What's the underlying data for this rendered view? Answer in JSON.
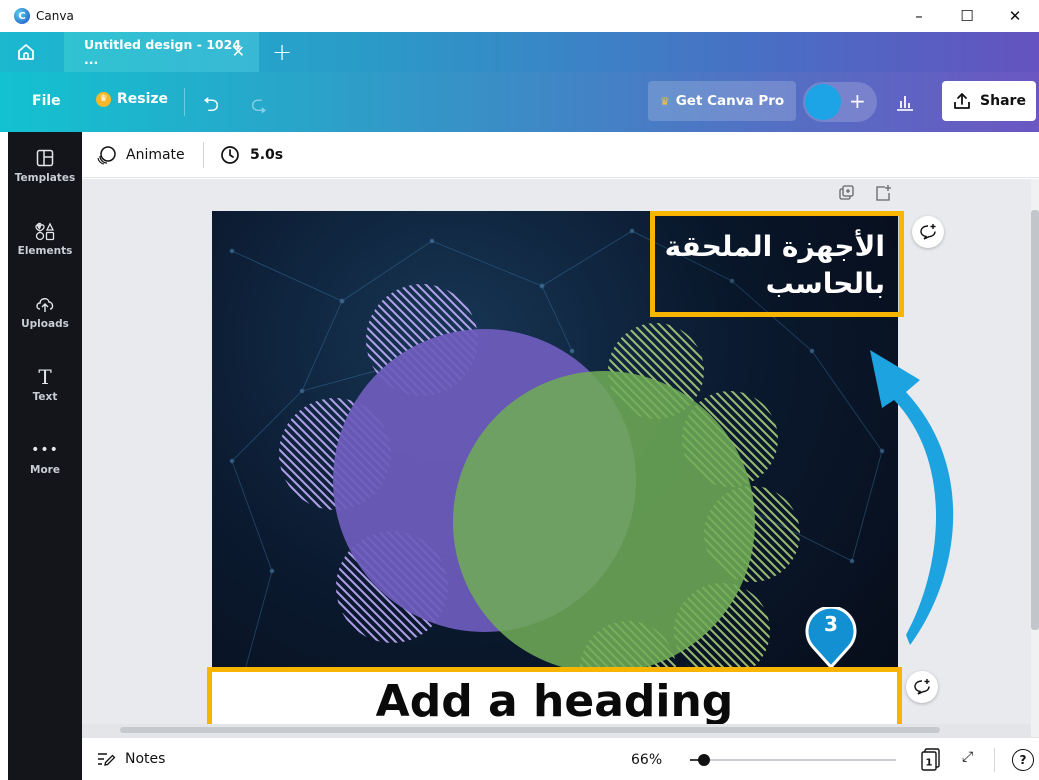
{
  "window": {
    "app_name": "Canva",
    "minimize": "–",
    "maximize": "☐",
    "close": "✕"
  },
  "tabs": {
    "active_title": "Untitled design - 1024 ...",
    "close": "✕",
    "new_tab": "+"
  },
  "toolbar": {
    "file_label": "File",
    "resize_label": "Resize",
    "get_pro_label": "Get Canva Pro",
    "share_label": "Share",
    "add_label": "+",
    "avatar_color": "#1da4e6"
  },
  "sidebar": {
    "items": [
      {
        "label": "Templates",
        "icon": "templates-icon"
      },
      {
        "label": "Elements",
        "icon": "elements-icon"
      },
      {
        "label": "Uploads",
        "icon": "uploads-icon"
      },
      {
        "label": "Text",
        "icon": "text-icon"
      },
      {
        "label": "More",
        "icon": "more-icon"
      }
    ]
  },
  "subtoolbar": {
    "animate_label": "Animate",
    "duration": "5.0s"
  },
  "canvas": {
    "title_text": "الأجهزة الملحقة بالحاسب",
    "heading_text": "Add a heading",
    "highlight_color": "#f7b500",
    "step_number": "3",
    "step_color": "#1390d2",
    "circle_colors": {
      "purple": "#6a5bb6",
      "green": "#6fa656"
    }
  },
  "bottombar": {
    "notes_label": "Notes",
    "zoom": "66%",
    "zoom_fraction": 0.066,
    "page_count": "1",
    "help": "?"
  }
}
